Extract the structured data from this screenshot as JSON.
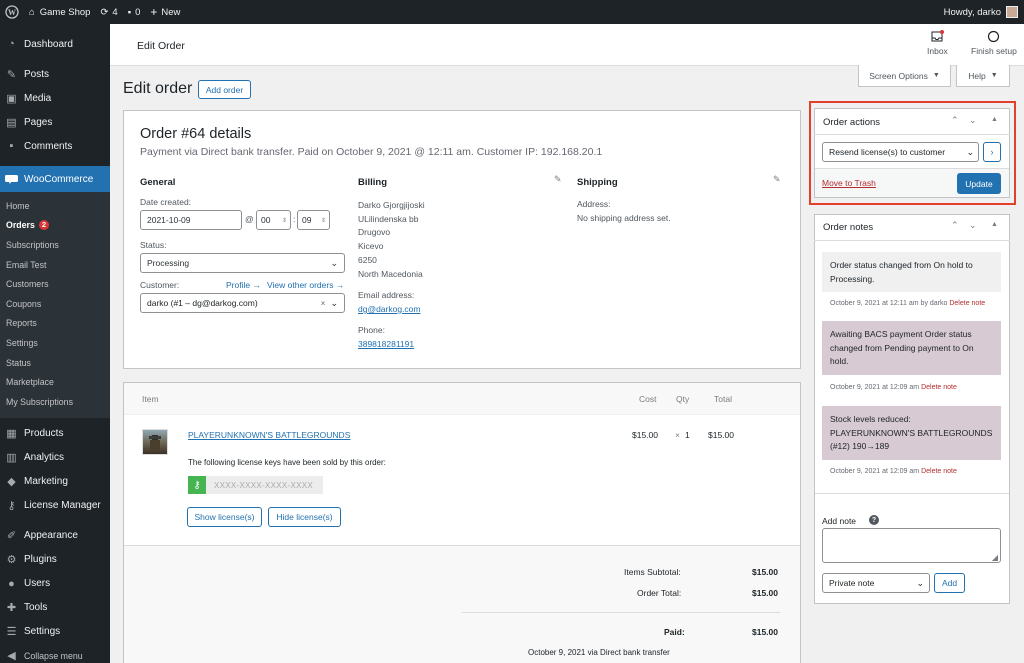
{
  "adminbar": {
    "site_name": "Game Shop",
    "updates": "4",
    "comments": "0",
    "new_label": "New",
    "howdy": "Howdy, darko"
  },
  "sidebar": {
    "top": [
      {
        "label": "Dashboard",
        "icon": "dashboard-icon"
      },
      {
        "label": "Posts",
        "icon": "pin-icon"
      },
      {
        "label": "Media",
        "icon": "media-icon"
      },
      {
        "label": "Pages",
        "icon": "pages-icon"
      },
      {
        "label": "Comments",
        "icon": "comments-icon"
      }
    ],
    "woocommerce": "WooCommerce",
    "sub": [
      "Home",
      "Orders",
      "Subscriptions",
      "Email Test",
      "Customers",
      "Coupons",
      "Reports",
      "Settings",
      "Status",
      "Marketplace",
      "My Subscriptions"
    ],
    "orders_count": "2",
    "bottom": [
      {
        "label": "Products",
        "icon": "products-icon"
      },
      {
        "label": "Analytics",
        "icon": "analytics-icon"
      },
      {
        "label": "Marketing",
        "icon": "marketing-icon"
      },
      {
        "label": "License Manager",
        "icon": "key-icon"
      },
      {
        "label": "Appearance",
        "icon": "brush-icon"
      },
      {
        "label": "Plugins",
        "icon": "plugin-icon"
      },
      {
        "label": "Users",
        "icon": "user-icon"
      },
      {
        "label": "Tools",
        "icon": "wrench-icon"
      },
      {
        "label": "Settings",
        "icon": "settings-icon"
      }
    ],
    "collapse": "Collapse menu"
  },
  "header": {
    "title": "Edit Order",
    "inbox": "Inbox",
    "finish_setup": "Finish setup",
    "screen_options": "Screen Options",
    "help": "Help"
  },
  "page": {
    "title": "Edit order",
    "add_order": "Add order"
  },
  "order": {
    "heading": "Order #64 details",
    "subheading": "Payment via Direct bank transfer. Paid on October 9, 2021 @ 12:11 am. Customer IP: 192.168.20.1",
    "general": {
      "title": "General",
      "date_label": "Date created:",
      "date": "2021-10-09",
      "at": "@",
      "hour": "00",
      "minute": "09",
      "colon": ":",
      "status_label": "Status:",
      "status": "Processing",
      "customer_label": "Customer:",
      "profile_link": "Profile →",
      "view_orders_link": "View other orders →",
      "customer": "darko (#1 – dg@darkog.com)"
    },
    "billing": {
      "title": "Billing",
      "lines": [
        "Darko Gjorgjijoski",
        "ULilindenska bb",
        "Drugovo",
        "Kicevo",
        "6250",
        "North Macedonia"
      ],
      "email_label": "Email address:",
      "email": "dg@darkog.com",
      "phone_label": "Phone:",
      "phone": "389818281191"
    },
    "shipping": {
      "title": "Shipping",
      "address_label": "Address:",
      "address": "No shipping address set."
    }
  },
  "items": {
    "headers": {
      "item": "Item",
      "cost": "Cost",
      "qty": "Qty",
      "total": "Total"
    },
    "product": {
      "name": "PLAYERUNKNOWN'S BATTLEGROUNDS",
      "cost": "$15.00",
      "qty_prefix": "×",
      "qty": "1",
      "total": "$15.00"
    },
    "license_text": "The following license keys have been sold by this order:",
    "license_key": "XXXX-XXXX-XXXX-XXXX",
    "show_btn": "Show license(s)",
    "hide_btn": "Hide license(s)",
    "subtotal_label": "Items Subtotal:",
    "subtotal": "$15.00",
    "total_label": "Order Total:",
    "total": "$15.00",
    "paid_label": "Paid:",
    "paid": "$15.00",
    "paid_note": "October 9, 2021 via Direct bank transfer"
  },
  "actions": {
    "title": "Order actions",
    "selected": "Resend license(s) to customer",
    "trash": "Move to Trash",
    "update": "Update"
  },
  "notes": {
    "title": "Order notes",
    "items": [
      {
        "text": "Order status changed from On hold to Processing.",
        "date": "October 9, 2021 at 12:11 am",
        "by": "by darko",
        "delete": "Delete note"
      },
      {
        "text": "Awaiting BACS payment Order status changed from Pending payment to On hold.",
        "date": "October 9, 2021 at 12:09 am",
        "by": "",
        "delete": "Delete note"
      },
      {
        "text": "Stock levels reduced: PLAYERUNKNOWN'S BATTLEGROUNDS (#12) 190→189",
        "date": "October 9, 2021 at 12:09 am",
        "by": "",
        "delete": "Delete note"
      }
    ],
    "add_note_label": "Add note",
    "help": "?",
    "type": "Private note",
    "add_btn": "Add"
  },
  "colors": {
    "admin_dark": "#1d2327",
    "accent": "#2271b1",
    "highlight": "#e0402c",
    "note_customer": "#d7cad2",
    "note_system": "#f0f0f1"
  }
}
